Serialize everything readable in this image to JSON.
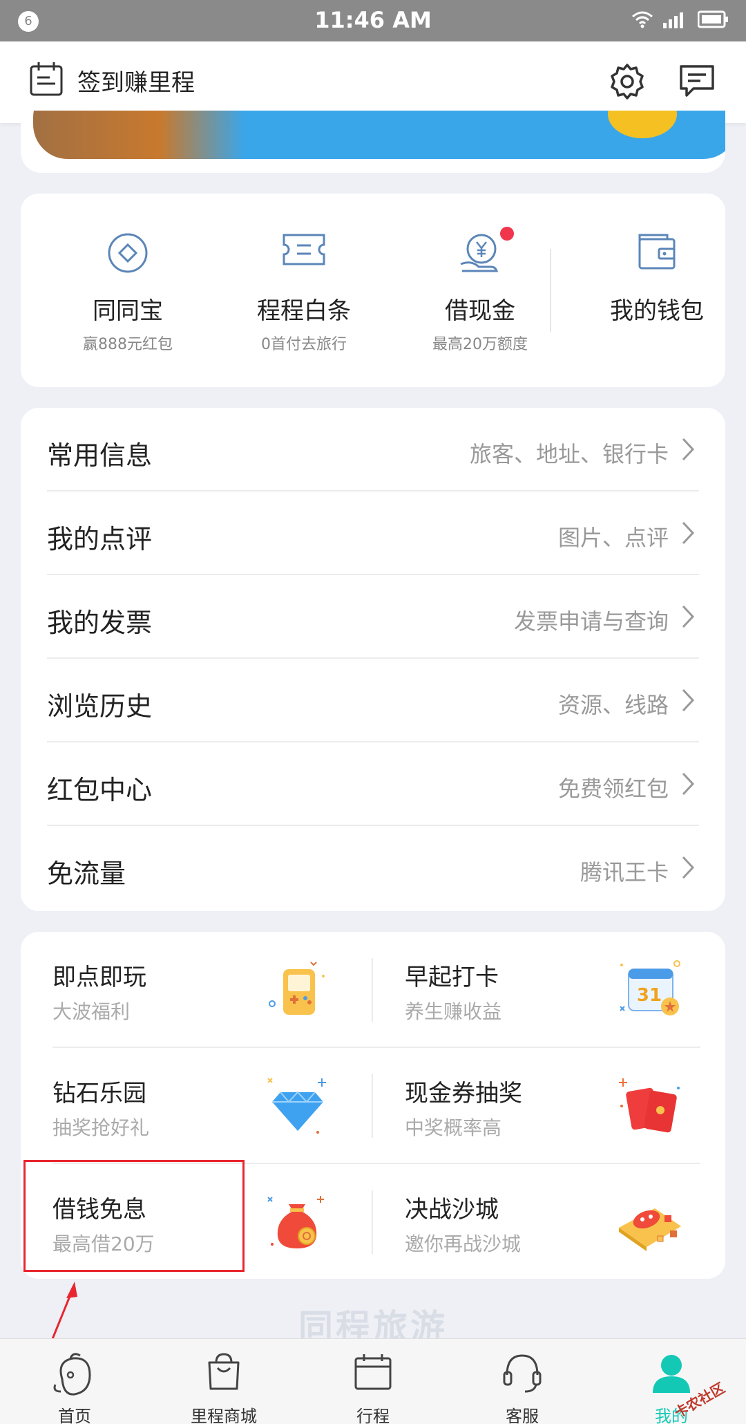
{
  "status_bar": {
    "notification_count": "6",
    "time": "11:46 AM",
    "icons": [
      "wifi-icon",
      "signal-icon",
      "battery-icon"
    ]
  },
  "header": {
    "title": "签到赚里程",
    "icons": [
      "calendar-icon",
      "settings-icon",
      "message-icon"
    ]
  },
  "finance": {
    "items": [
      {
        "label": "同同宝",
        "sub": "赢888元红包",
        "icon": "diamond-coin-icon"
      },
      {
        "label": "程程白条",
        "sub": "0首付去旅行",
        "icon": "ticket-icon"
      },
      {
        "label": "借现金",
        "sub": "最高20万额度",
        "icon": "yen-coin-icon",
        "badge": true
      },
      {
        "label": "我的钱包",
        "sub": "",
        "icon": "wallet-icon"
      }
    ]
  },
  "menu": {
    "items": [
      {
        "label": "常用信息",
        "hint": "旅客、地址、银行卡"
      },
      {
        "label": "我的点评",
        "hint": "图片、点评"
      },
      {
        "label": "我的发票",
        "hint": "发票申请与查询"
      },
      {
        "label": "浏览历史",
        "hint": "资源、线路"
      },
      {
        "label": "红包中心",
        "hint": "免费领红包"
      },
      {
        "label": "免流量",
        "hint": "腾讯王卡"
      }
    ]
  },
  "grid": {
    "items": [
      {
        "title": "即点即玩",
        "sub": "大波福利",
        "icon": "game-console-icon"
      },
      {
        "title": "早起打卡",
        "sub": "养生赚收益",
        "icon": "calendar-31-icon",
        "calendar_day": "31"
      },
      {
        "title": "钻石乐园",
        "sub": "抽奖抢好礼",
        "icon": "diamond-icon"
      },
      {
        "title": "现金券抽奖",
        "sub": "中奖概率高",
        "icon": "red-envelope-icon"
      },
      {
        "title": "借钱免息",
        "sub": "最高借20万",
        "icon": "money-bag-icon"
      },
      {
        "title": "决战沙城",
        "sub": "邀你再战沙城",
        "icon": "gamepad-icon"
      }
    ]
  },
  "footer": {
    "logo_text": "同程旅游"
  },
  "bottom_nav": {
    "items": [
      {
        "label": "首页",
        "icon": "home-mascot-icon"
      },
      {
        "label": "里程商城",
        "icon": "shopping-bag-icon"
      },
      {
        "label": "行程",
        "icon": "itinerary-calendar-icon"
      },
      {
        "label": "客服",
        "icon": "headset-icon"
      },
      {
        "label": "我的",
        "icon": "user-icon",
        "active": true
      }
    ]
  },
  "watermark": "卡农社区",
  "colors": {
    "accent": "#13c9b6",
    "highlight": "#e8262f",
    "icon_blue": "#5b86b8",
    "badge": "#f0364c"
  }
}
